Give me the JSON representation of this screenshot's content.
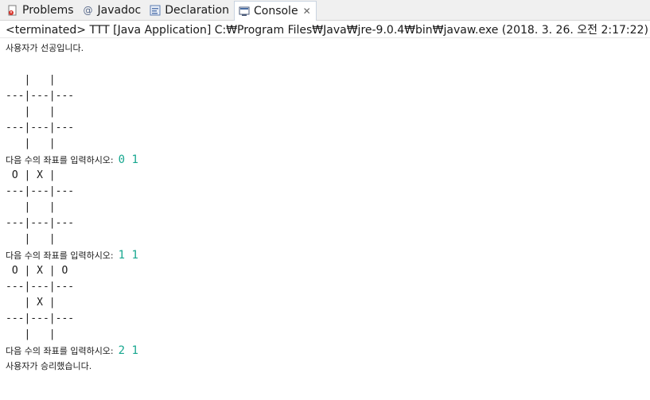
{
  "tabs": [
    {
      "label": "Problems",
      "icon": "problems-icon"
    },
    {
      "label": "Javadoc",
      "icon": "at-icon"
    },
    {
      "label": "Declaration",
      "icon": "declaration-icon"
    },
    {
      "label": "Console",
      "icon": "console-icon",
      "active": true,
      "close": "✕"
    }
  ],
  "console": {
    "header": "<terminated> TTT [Java Application] C:₩Program Files₩Java₩jre-9.0.4₩bin₩javaw.exe (2018. 3. 26. 오전 2:17:22)",
    "lines": [
      "사용자가 선공입니다.",
      "",
      "   |   |",
      "---|---|---",
      "   |   |",
      "---|---|---",
      "   |   |",
      "다음 수의 좌표를 입력하시오:",
      " O | X |",
      "---|---|---",
      "   |   |",
      "---|---|---",
      "   |   |",
      "다음 수의 좌표를 입력하시오:",
      " O | X | O",
      "---|---|---",
      "   | X |",
      "---|---|---",
      "   |   |",
      "다음 수의 좌표를 입력하시오:",
      "사용자가 승리했습니다."
    ],
    "inputs": [
      "0 1",
      "1 1",
      "2 1"
    ]
  },
  "colors": {
    "input_text": "#17a78f",
    "tabbar_bg": "#f0f0f0"
  }
}
